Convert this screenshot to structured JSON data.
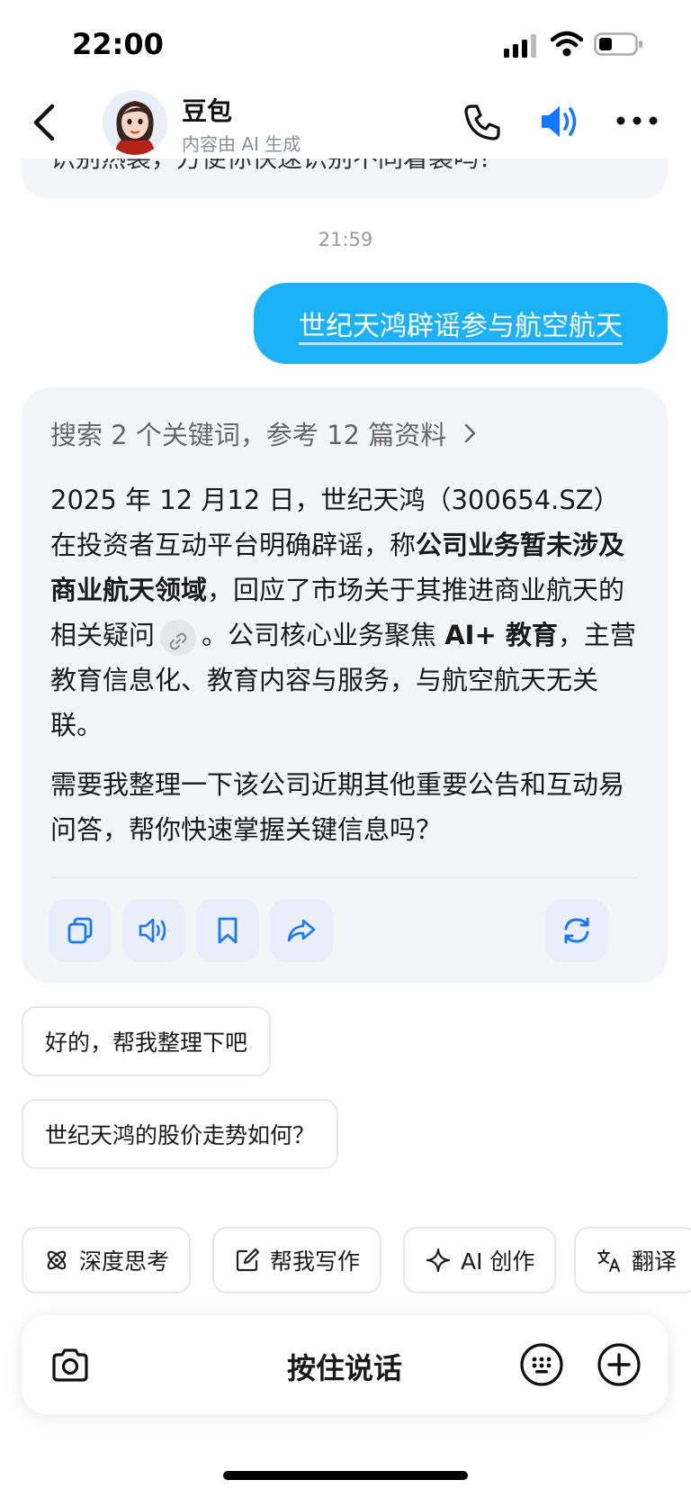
{
  "status_bar": {
    "time": "22:00"
  },
  "header": {
    "title": "豆包",
    "subtitle": "内容由 AI 生成",
    "icons": [
      "back-icon",
      "avatar",
      "phone-icon",
      "speaker-icon",
      "more-icon"
    ],
    "accent_color": "#1677ff"
  },
  "chat": {
    "previous_message_tail": "识别热装，方便你快速识别不同着装吗？",
    "timestamp": "21:59",
    "user_message": "世纪天鸿辟谣参与航空航天",
    "reply": {
      "search_summary": "搜索 2 个关键词，参考 12 篇资料",
      "p1_a": "2025 年 12 月12 日，世纪天鸿（300654.SZ）在投资者互动平台明确辟谣，称",
      "p1_bold1": "公司业务暂未涉及商业航天领域",
      "p1_b": "，回应了市场关于其推进商业航天的相关疑问",
      "p1_c": "。公司核心业务聚焦 ",
      "p1_bold2": "AI+ 教育",
      "p1_d": "，主营教育信息化、教育内容与服务，与航空航天无关联。",
      "p2": "需要我整理一下该公司近期其他重要公告和互动易问答，帮你快速掌握关键信息吗？"
    },
    "actions": [
      "copy-icon",
      "read-aloud-icon",
      "bookmark-icon",
      "share-icon",
      "regenerate-icon"
    ]
  },
  "suggestions": [
    "好的，帮我整理下吧",
    "世纪天鸿的股价走势如何？"
  ],
  "chips": [
    {
      "icon": "atom-icon",
      "label": "深度思考"
    },
    {
      "icon": "edit-icon",
      "label": "帮我写作"
    },
    {
      "icon": "sparkle-icon",
      "label": "AI 创作"
    },
    {
      "icon": "translate-icon",
      "label": "翻译"
    }
  ],
  "input_bar": {
    "hold_to_talk": "按住说话"
  },
  "colors": {
    "user_bubble": "#1bb2f7",
    "card_bg": "#f4f5f7",
    "action_bg": "#e9eef9",
    "action_icon": "#1677ff"
  }
}
